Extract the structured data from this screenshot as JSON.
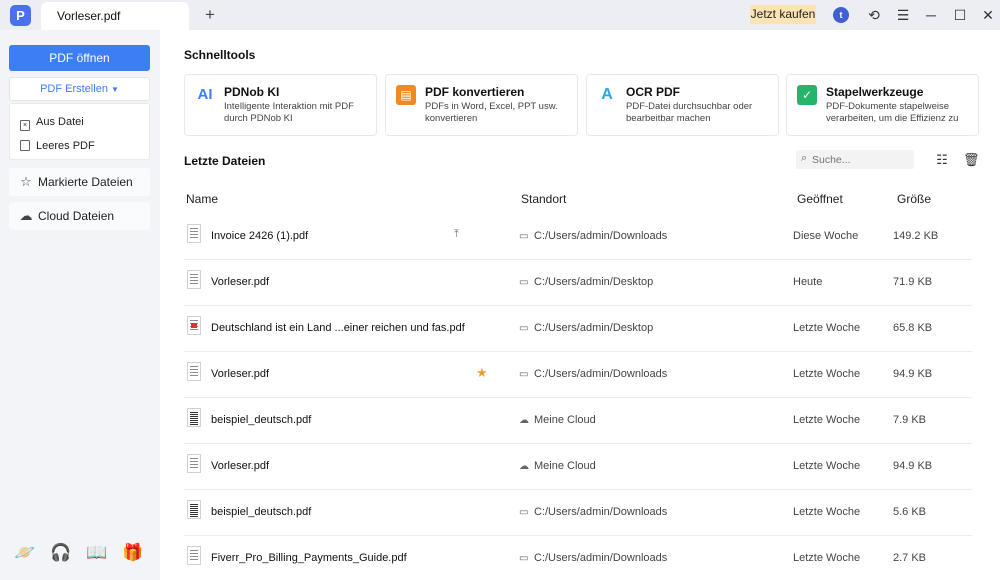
{
  "titlebar": {
    "app_icon": "pdnob-logo-icon",
    "tab_label": "Vorleser.pdf",
    "new_tab_label": "+",
    "buy_label": "Jetzt kaufen",
    "user_initial": "t",
    "icons": [
      "user-icon",
      "refresh-icon",
      "menu-icon",
      "minimize-icon",
      "maximize-icon",
      "close-icon"
    ]
  },
  "sidebar": {
    "open_label": "PDF öffnen",
    "create_label": "PDF Erstellen",
    "create_items": [
      {
        "label": "Aus Datei",
        "icon": "file-icon"
      },
      {
        "label": "Leeres PDF",
        "icon": "blank-page-icon"
      }
    ],
    "nav": [
      {
        "label": "Markierte Dateien",
        "icon": "star-icon"
      },
      {
        "label": "Cloud Dateien",
        "icon": "cloud-icon"
      }
    ],
    "footer_icons": [
      "planet-icon",
      "headset-icon",
      "book-icon",
      "gift-icon"
    ]
  },
  "schnelltools": {
    "title": "Schnelltools",
    "tools": [
      {
        "name": "PDNob KI",
        "desc": "Intelligente Interaktion mit PDF durch PDNob KI",
        "icon": "ai-icon",
        "color": "#3e7ef5"
      },
      {
        "name": "PDF konvertieren",
        "desc": "PDFs in Word, Excel, PPT usw. konvertieren",
        "icon": "convert-icon",
        "color": "#f08a24"
      },
      {
        "name": "OCR PDF",
        "desc": "PDF-Datei durchsuchbar oder bearbeitbar machen",
        "icon": "ocr-icon",
        "color": "#2aa7e8"
      },
      {
        "name": "Stapelwerkzeuge",
        "desc": "PDF-Dokumente stapelweise verarbeiten, um die Effizienz zu",
        "icon": "batch-icon",
        "color": "#24b56a"
      }
    ]
  },
  "recent": {
    "title": "Letzte Dateien",
    "search_placeholder": "Suche...",
    "columns": {
      "name": "Name",
      "location": "Standort",
      "opened": "Geöffnet",
      "size": "Größe"
    },
    "files": [
      {
        "name": "Invoice 2426 (1).pdf",
        "location": "C:/Users/admin/Downloads",
        "loc_type": "folder",
        "opened": "Diese Woche",
        "size": "149.2 KB",
        "action": "pin"
      },
      {
        "name": "Vorleser.pdf",
        "location": "C:/Users/admin/Desktop",
        "loc_type": "folder",
        "opened": "Heute",
        "size": "71.9 KB"
      },
      {
        "name": "Deutschland ist ein Land ...einer reichen und fas.pdf",
        "location": "C:/Users/admin/Desktop",
        "loc_type": "folder",
        "opened": "Letzte Woche",
        "size": "65.8 KB",
        "thumb": "red"
      },
      {
        "name": "Vorleser.pdf",
        "location": "C:/Users/admin/Downloads",
        "loc_type": "folder",
        "opened": "Letzte Woche",
        "size": "94.9 KB",
        "action": "star"
      },
      {
        "name": "beispiel_deutsch.pdf",
        "location": "Meine Cloud",
        "loc_type": "cloud",
        "opened": "Letzte Woche",
        "size": "7.9 KB",
        "thumb": "dense"
      },
      {
        "name": "Vorleser.pdf",
        "location": "Meine Cloud",
        "loc_type": "cloud",
        "opened": "Letzte Woche",
        "size": "94.9 KB"
      },
      {
        "name": "beispiel_deutsch.pdf",
        "location": "C:/Users/admin/Downloads",
        "loc_type": "folder",
        "opened": "Letzte Woche",
        "size": "5.6 KB",
        "thumb": "dense"
      },
      {
        "name": "Fiverr_Pro_Billing_Payments_Guide.pdf",
        "location": "C:/Users/admin/Downloads",
        "loc_type": "folder",
        "opened": "Letzte Woche",
        "size": "2.7 KB"
      }
    ]
  }
}
